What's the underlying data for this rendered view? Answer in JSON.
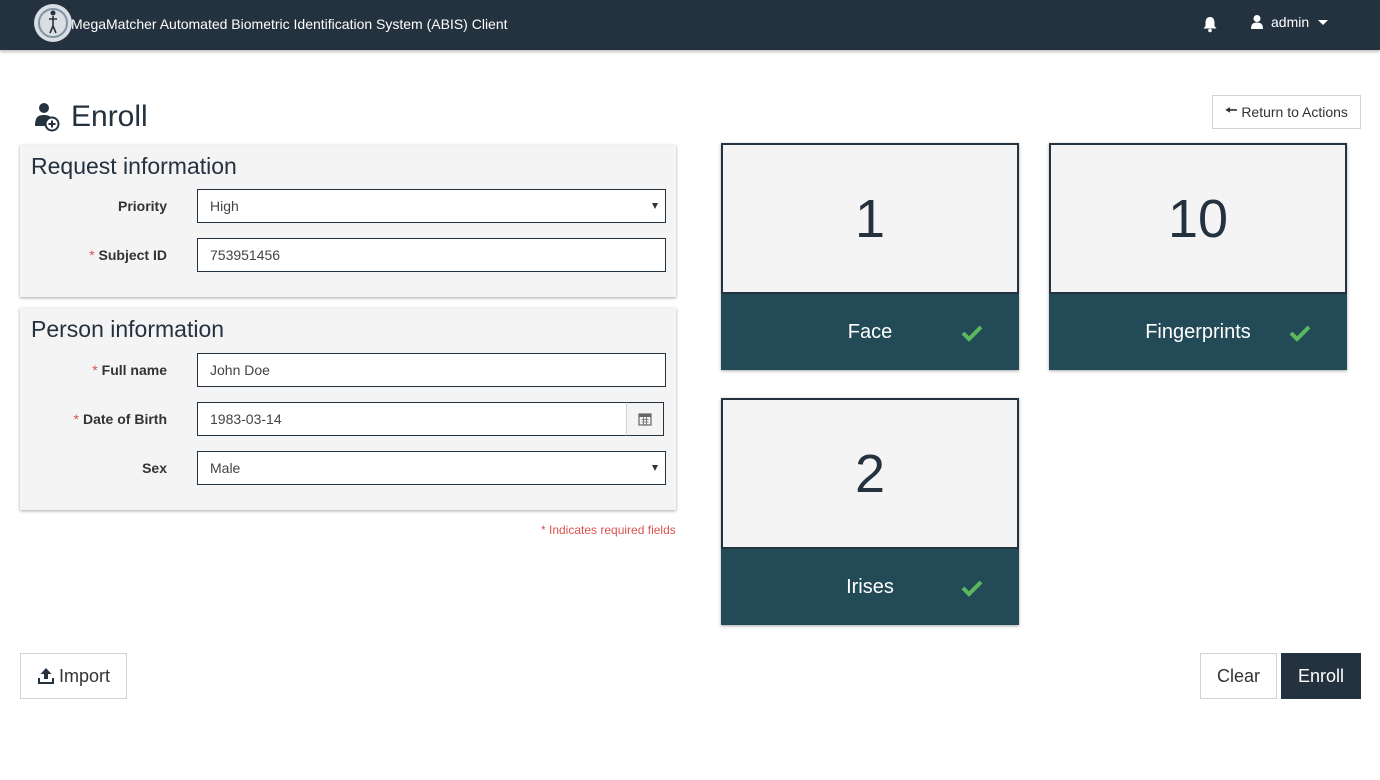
{
  "header": {
    "app_title": "MegaMatcher Automated Biometric Identification System (ABIS) Client",
    "user_name": "admin",
    "icons": [
      "logo-icon",
      "bell-icon",
      "user-icon",
      "chevron-down-icon"
    ]
  },
  "page": {
    "title": "Enroll",
    "return_label": "Return to Actions"
  },
  "request_panel": {
    "heading": "Request information",
    "priority_label": "Priority",
    "priority_value": "High",
    "subject_id_label": "Subject ID",
    "subject_id_value": "753951456"
  },
  "person_panel": {
    "heading": "Person information",
    "full_name_label": "Full name",
    "full_name_value": "John Doe",
    "dob_label": "Date of Birth",
    "dob_value": "1983-03-14",
    "sex_label": "Sex",
    "sex_value": "Male"
  },
  "required_marker": "*",
  "required_note": "* Indicates required fields",
  "tiles": [
    {
      "count": "1",
      "label": "Face"
    },
    {
      "count": "10",
      "label": "Fingerprints"
    },
    {
      "count": "2",
      "label": "Irises"
    }
  ],
  "actions": {
    "import_label": "Import",
    "clear_label": "Clear",
    "enroll_label": "Enroll"
  },
  "colors": {
    "navbar": "#24313f",
    "tile_footer": "#234a57",
    "check": "#5cb85c",
    "required": "#d9534f"
  }
}
